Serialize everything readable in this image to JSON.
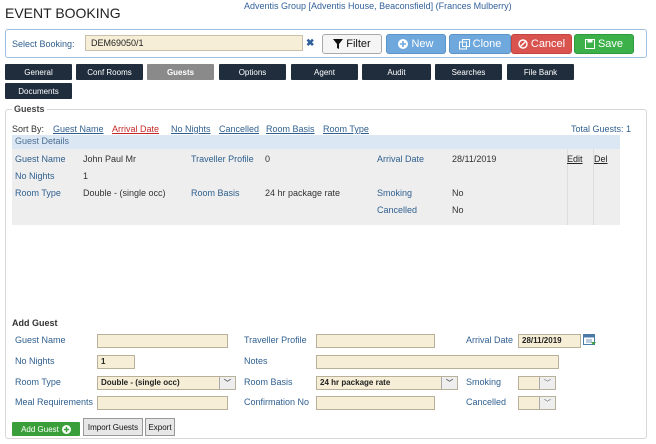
{
  "header": {
    "title": "EVENT BOOKING",
    "company": "Adventis Group [Adventis House, Beaconsfield] (Frances Mulberry)"
  },
  "booking": {
    "label": "Select Booking:",
    "value": "DEM69050/1"
  },
  "toolbar": {
    "filter": "Filter",
    "new": "New",
    "clone": "Clone",
    "cancel": "Cancel",
    "save": "Save"
  },
  "tabs": [
    "General",
    "Conf Rooms",
    "Guests",
    "Options",
    "Agent",
    "Audit",
    "Searches",
    "File Bank",
    "Documents"
  ],
  "active_tab": "Guests",
  "guests": {
    "section_title": "Guests",
    "sort_by_label": "Sort By:",
    "sort_options": [
      "Guest Name",
      "Arrival Date",
      "No Nights",
      "Cancelled",
      "Room Basis",
      "Room Type"
    ],
    "active_sort": "Arrival Date",
    "total_label": "Total Guests: 1",
    "details_header": "Guest Details",
    "guest": {
      "guest_name_label": "Guest Name",
      "guest_name": "John Paul Mr",
      "traveller_profile_label": "Traveller Profile",
      "traveller_profile": "0",
      "arrival_date_label": "Arrival Date",
      "arrival_date": "28/11/2019",
      "no_nights_label": "No Nights",
      "no_nights": "1",
      "room_type_label": "Room Type",
      "room_type": "Double - (single occ)",
      "room_basis_label": "Room Basis",
      "room_basis": "24 hr package rate",
      "smoking_label": "Smoking",
      "smoking": "No",
      "cancelled_label": "Cancelled",
      "cancelled": "No",
      "edit": "Edit",
      "del": "Del"
    }
  },
  "add_guest": {
    "title": "Add Guest",
    "guest_name_label": "Guest Name",
    "guest_name": "",
    "traveller_profile_label": "Traveller Profile",
    "traveller_profile": "",
    "arrival_date_label": "Arrival Date",
    "arrival_date": "28/11/2019",
    "no_nights_label": "No Nights",
    "no_nights": "1",
    "notes_label": "Notes",
    "notes": "",
    "room_type_label": "Room Type",
    "room_type": "Double - (single occ)",
    "room_basis_label": "Room Basis",
    "room_basis": "24 hr package rate",
    "smoking_label": "Smoking",
    "smoking": "",
    "meal_label": "Meal Requirements",
    "meal": "",
    "confirmation_label": "Confirmation No",
    "confirmation": "",
    "cancelled_label": "Cancelled",
    "cancelled": "",
    "add_button": "Add Guest",
    "import_button": "Import Guests",
    "export_button": "Export"
  },
  "colors": {
    "tab_bg": "#1f2d3d",
    "tab_active": "#8a8a8a",
    "input_bg": "#f6eed6",
    "link_blue": "#2f5f8f",
    "save_green": "#3cb14a",
    "cancel_red": "#d9534f",
    "action_blue": "#6fa8dc"
  }
}
